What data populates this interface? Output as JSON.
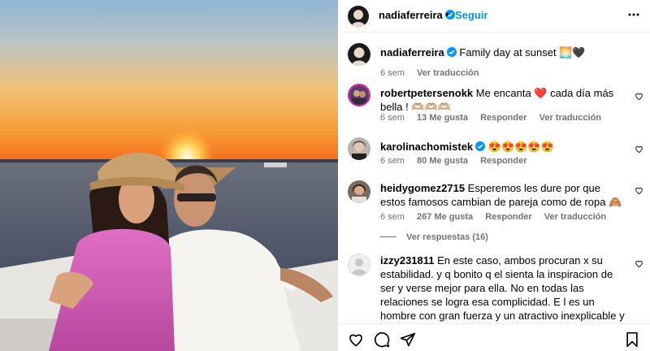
{
  "header": {
    "username": "nadiaferreira",
    "separator": "•",
    "follow_label": "Seguir"
  },
  "caption": {
    "username": "nadiaferreira",
    "text": "Family day at sunset 🌅🖤",
    "age": "6 sem",
    "translate": "Ver traducción"
  },
  "comments": [
    {
      "username": "robertpetersenokk",
      "text": "Me encanta ❤️ cada día más bella ! 🫶🏼🫶🏼🫶🏼",
      "age": "6 sem",
      "likes": "13 Me gusta",
      "reply": "Responder",
      "translate": "Ver traducción"
    },
    {
      "username": "karolinachomistek",
      "text": "😍😍😍😍😍",
      "age": "6 sem",
      "likes": "80 Me gusta",
      "reply": "Responder"
    },
    {
      "username": "heidygomez2715",
      "text": "Esperemos les dure por que estos famosos cambian de pareja como de ropa 🙈",
      "age": "6 sem",
      "likes": "267 Me gusta",
      "reply": "Responder",
      "translate": "Ver traducción",
      "view_replies": "Ver respuestas (16)"
    },
    {
      "username": "izzy231811",
      "text": "En este caso, ambos procuran x su estabilidad. y q bonito q el sienta la inspiracion de ser y verse mejor para ella. No en todas las relaciones se logra esa complicidad. E l es un hombre con gran fuerza y un atractivo inexplicable y Nadia lo alienta a se vea y se sienta mejor x su salud y como artista y esposo de una atractiva, famosa e inteligente chica."
    }
  ],
  "icons": {
    "verified": "verified-badge-icon",
    "more": "more-options-icon",
    "heart": "heart-outline-icon",
    "comment": "comment-icon",
    "share": "send-icon",
    "save": "bookmark-icon"
  },
  "colors": {
    "accent": "#0095f6",
    "muted": "#737373",
    "verified": "#0095f6"
  }
}
